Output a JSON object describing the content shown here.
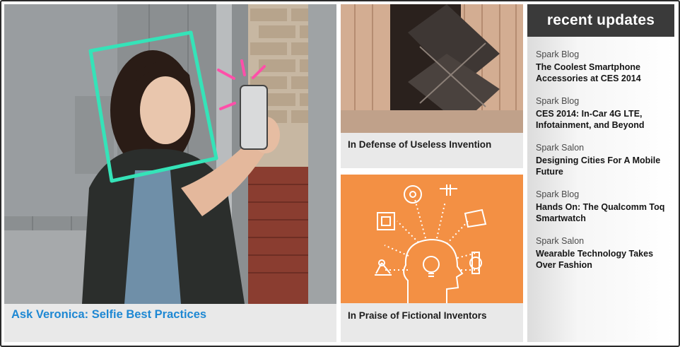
{
  "hero": {
    "caption": "Ask Veronica: Selfie Best Practices",
    "link_color": "#1e88d3",
    "image_subject": "woman-taking-selfie"
  },
  "cards": [
    {
      "caption": "In Defense of Useless Invention",
      "image_subject": "wall-door-sculpture"
    },
    {
      "caption": "In Praise of Fictional Inventors",
      "image_subject": "lightbulb-inventions-illustration",
      "bg_color": "#f39044"
    }
  ],
  "sidebar": {
    "title": "recent updates",
    "items": [
      {
        "category": "Spark Blog",
        "title": "The Coolest Smartphone Accessories at CES 2014"
      },
      {
        "category": "Spark Blog",
        "title": "CES 2014: In-Car 4G LTE, Infotainment, and Beyond"
      },
      {
        "category": "Spark Salon",
        "title": "Designing Cities For A Mobile Future"
      },
      {
        "category": "Spark Blog",
        "title": "Hands On: The Qualcomm Toq Smartwatch"
      },
      {
        "category": "Spark Salon",
        "title": "Wearable Technology Takes Over Fashion"
      }
    ]
  }
}
